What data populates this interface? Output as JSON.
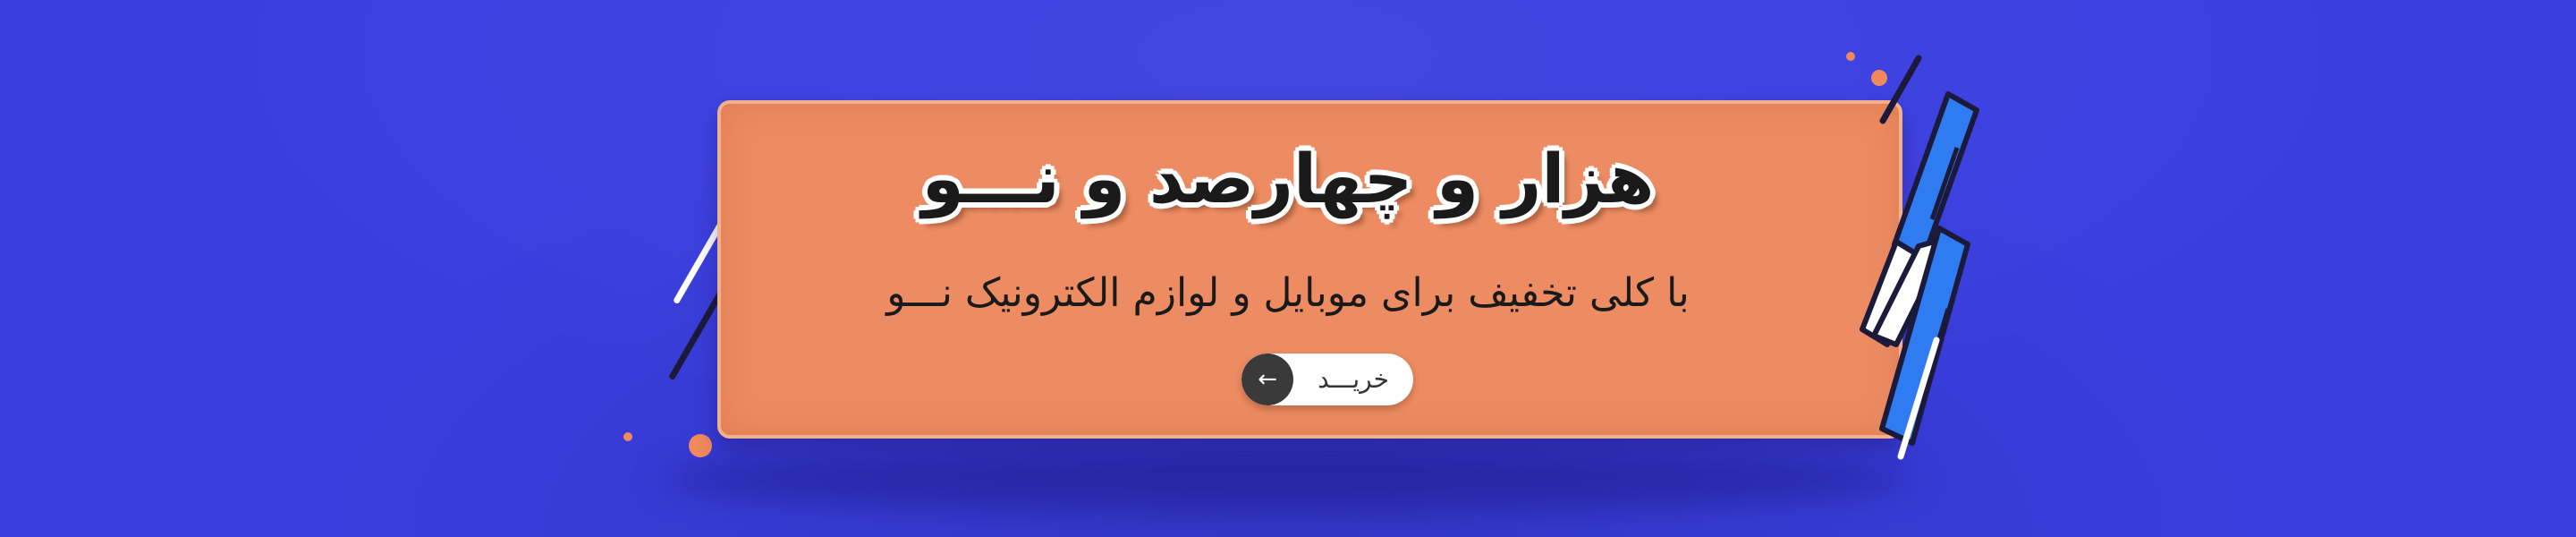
{
  "banner": {
    "headline": "هزار و چهارصد و نـــو",
    "subheadline": "با کلی تخفیف برای موبایل و لوازم الکترونیک نـــو",
    "cta_label": "خریـــد",
    "cta_icon": "arrow-left-icon"
  },
  "colors": {
    "background": "#3a3ee0",
    "card": "#ed8c62",
    "bolt_blue": "#2f7bf2",
    "bolt_white": "#ffffff",
    "outline": "#1b1a3a",
    "dot_accent": "#f08a5d"
  }
}
